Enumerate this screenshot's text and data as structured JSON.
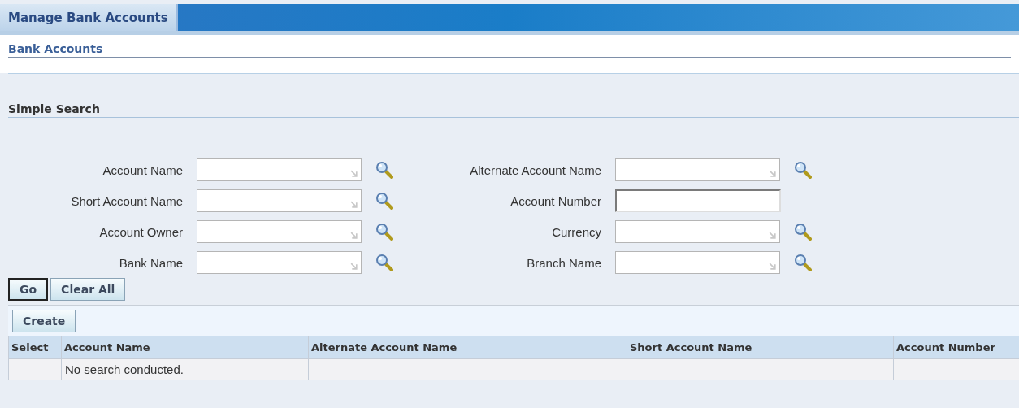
{
  "tabs": [
    {
      "label": "Manage Bank Accounts",
      "selected": true
    }
  ],
  "page_title": "Bank Accounts",
  "search": {
    "title": "Simple Search",
    "rows": [
      [
        {
          "label": "Account Name",
          "kind": "lov"
        },
        {
          "label": "Alternate Account Name",
          "kind": "lov"
        }
      ],
      [
        {
          "label": "Short Account Name",
          "kind": "lov"
        },
        {
          "label": "Account Number",
          "kind": "text"
        }
      ],
      [
        {
          "label": "Account Owner",
          "kind": "lov"
        },
        {
          "label": "Currency",
          "kind": "lov"
        }
      ],
      [
        {
          "label": "Bank Name",
          "kind": "lov"
        },
        {
          "label": "Branch Name",
          "kind": "lov"
        }
      ]
    ],
    "buttons": [
      {
        "label": "Go",
        "default": true
      },
      {
        "label": "Clear All",
        "default": false
      }
    ]
  },
  "toolbar": {
    "buttons": [
      "Create"
    ]
  },
  "table": {
    "columns": [
      "Select",
      "Account Name",
      "Alternate Account Name",
      "Short Account Name",
      "Account Number"
    ],
    "rows": [
      {
        "cells": [
          "",
          "No search conducted.",
          "",
          "",
          ""
        ]
      }
    ]
  }
}
